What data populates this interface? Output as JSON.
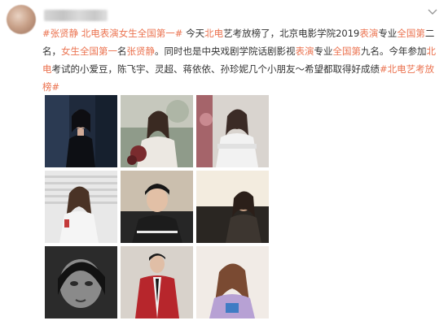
{
  "post": {
    "topic1": "#张贤静 北电表演女生全国第一#",
    "seg1": " 今天",
    "hl1": "北电",
    "seg2": "艺考放榜了，北京电影学院2019",
    "hl2": "表演",
    "seg3": "专业",
    "hl3": "全国第",
    "seg4": "二名，",
    "hl4": "女生全国第一",
    "seg5": "名",
    "mention1": "张贤静",
    "seg6": "。同时也是中央戏剧学院话剧影视",
    "hl5": "表演",
    "seg7": "专业",
    "hl6": "全国第",
    "seg8": "九名。今年参加",
    "hl7": "北电",
    "seg9": "考试的小爱豆，陈飞宇、灵超、蒋依依、孙珍妮几个小朋友～希望都取得好成绩",
    "topic2": "#北电艺考放榜#"
  },
  "icons": {
    "menu": "chevron-down-icon"
  },
  "photos": [
    {
      "name": "photo-1"
    },
    {
      "name": "photo-2"
    },
    {
      "name": "photo-3"
    },
    {
      "name": "photo-4"
    },
    {
      "name": "photo-5"
    },
    {
      "name": "photo-6"
    },
    {
      "name": "photo-7"
    },
    {
      "name": "photo-8"
    },
    {
      "name": "photo-9"
    }
  ],
  "colors": {
    "accent": "#eb7350",
    "text": "#333333"
  }
}
